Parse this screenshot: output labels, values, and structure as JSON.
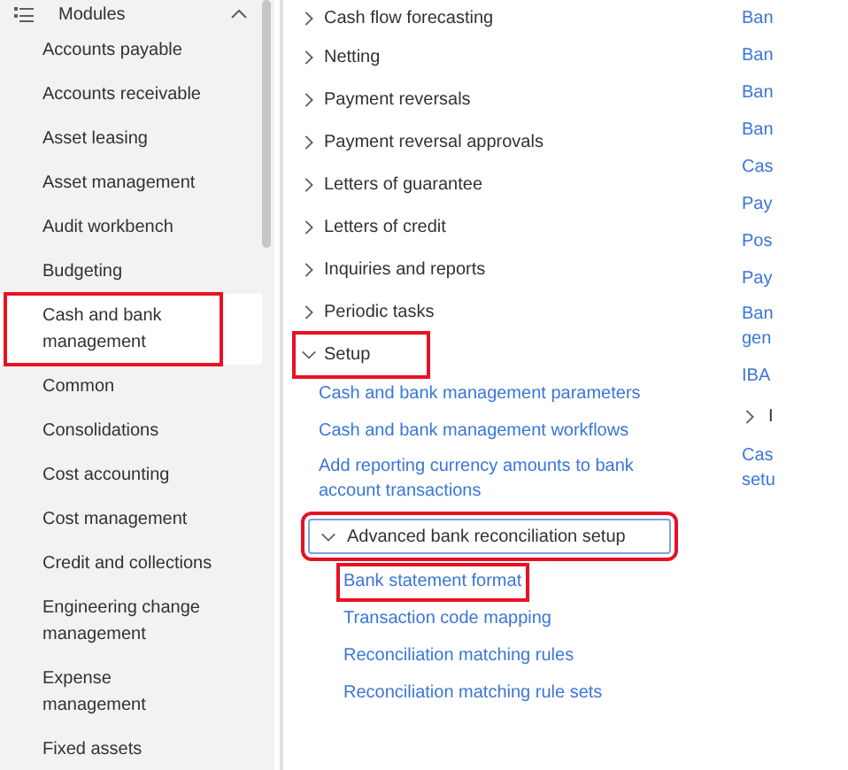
{
  "sidebar": {
    "title": "Modules",
    "expanded": true,
    "items": [
      {
        "label": "Accounts payable",
        "selected": false,
        "highlighted": false
      },
      {
        "label": "Accounts receivable",
        "selected": false,
        "highlighted": false
      },
      {
        "label": "Asset leasing",
        "selected": false,
        "highlighted": false
      },
      {
        "label": "Asset management",
        "selected": false,
        "highlighted": false
      },
      {
        "label": "Audit workbench",
        "selected": false,
        "highlighted": false
      },
      {
        "label": "Budgeting",
        "selected": false,
        "highlighted": false
      },
      {
        "label": "Cash and bank management",
        "selected": true,
        "highlighted": true
      },
      {
        "label": "Common",
        "selected": false,
        "highlighted": false
      },
      {
        "label": "Consolidations",
        "selected": false,
        "highlighted": false
      },
      {
        "label": "Cost accounting",
        "selected": false,
        "highlighted": false
      },
      {
        "label": "Cost management",
        "selected": false,
        "highlighted": false
      },
      {
        "label": "Credit and collections",
        "selected": false,
        "highlighted": false
      },
      {
        "label": "Engineering change management",
        "selected": false,
        "highlighted": false
      },
      {
        "label": "Expense management",
        "selected": false,
        "highlighted": false
      },
      {
        "label": "Fixed assets",
        "selected": false,
        "highlighted": false
      }
    ]
  },
  "groups": [
    {
      "label": "Cash flow forecasting",
      "expanded": false,
      "highlighted": false
    },
    {
      "label": "Netting",
      "expanded": false,
      "highlighted": false
    },
    {
      "label": "Payment reversals",
      "expanded": false,
      "highlighted": false
    },
    {
      "label": "Payment reversal approvals",
      "expanded": false,
      "highlighted": false
    },
    {
      "label": "Letters of guarantee",
      "expanded": false,
      "highlighted": false
    },
    {
      "label": "Letters of credit",
      "expanded": false,
      "highlighted": false
    },
    {
      "label": "Inquiries and reports",
      "expanded": false,
      "highlighted": false
    },
    {
      "label": "Periodic tasks",
      "expanded": false,
      "highlighted": false
    },
    {
      "label": "Setup",
      "expanded": true,
      "highlighted": true,
      "children": [
        {
          "kind": "link",
          "label": "Cash and bank management parameters",
          "highlighted": false
        },
        {
          "kind": "link",
          "label": "Cash and bank management workflows",
          "highlighted": false
        },
        {
          "kind": "link",
          "label": "Add reporting currency amounts to bank account transactions",
          "highlighted": false
        },
        {
          "kind": "group",
          "label": "Advanced bank reconciliation setup",
          "expanded": true,
          "highlighted": true,
          "children": [
            {
              "kind": "link",
              "label": "Bank statement format",
              "highlighted": true
            },
            {
              "kind": "link",
              "label": "Transaction code mapping",
              "highlighted": false
            },
            {
              "kind": "link",
              "label": "Reconciliation matching rules",
              "highlighted": false
            },
            {
              "kind": "link",
              "label": "Reconciliation matching rule sets",
              "highlighted": false
            }
          ]
        }
      ]
    }
  ],
  "related_links": [
    {
      "kind": "link",
      "label": "Ban"
    },
    {
      "kind": "link",
      "label": "Ban"
    },
    {
      "kind": "link",
      "label": "Ban"
    },
    {
      "kind": "link",
      "label": "Ban"
    },
    {
      "kind": "link",
      "label": "Cas"
    },
    {
      "kind": "link",
      "label": "Pay"
    },
    {
      "kind": "link",
      "label": "Pos"
    },
    {
      "kind": "link",
      "label": "Pay"
    },
    {
      "kind": "link",
      "label": "Ban gen"
    },
    {
      "kind": "link",
      "label": "IBA"
    },
    {
      "kind": "group",
      "label": "I",
      "expanded": false
    },
    {
      "kind": "link",
      "label": "Cas setu"
    }
  ]
}
